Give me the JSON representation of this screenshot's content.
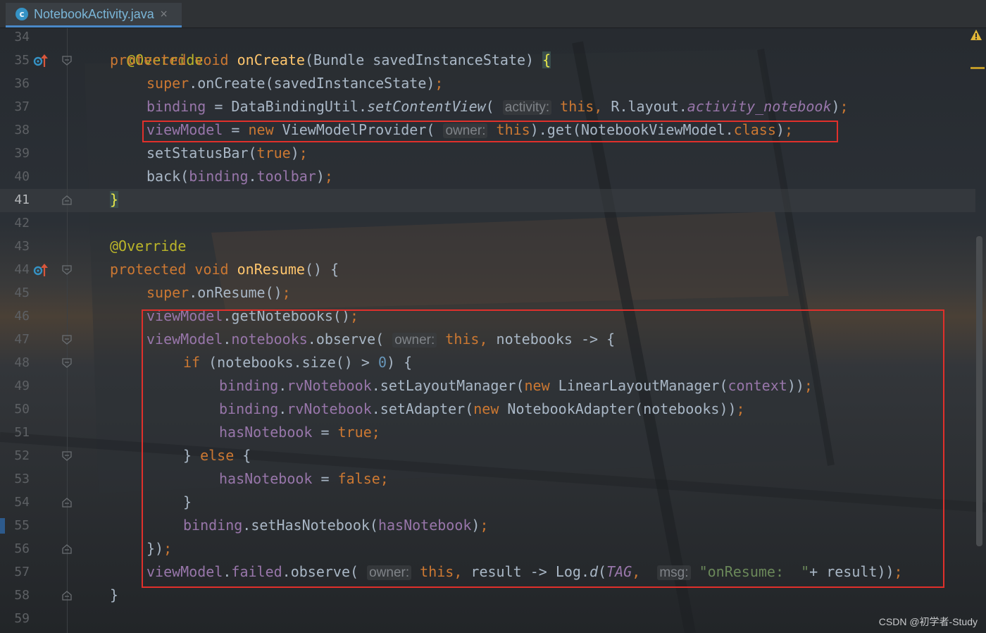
{
  "editor": {
    "tab": {
      "icon_letter": "c",
      "title": "NotebookActivity.java",
      "close_glyph": "×"
    }
  },
  "gutter": {
    "line_numbers": [
      "34",
      "35",
      "36",
      "37",
      "38",
      "39",
      "40",
      "41",
      "42",
      "43",
      "44",
      "45",
      "46",
      "47",
      "48",
      "49",
      "50",
      "51",
      "52",
      "53",
      "54",
      "55",
      "56",
      "57",
      "58",
      "59"
    ],
    "current_line": "41"
  },
  "code": {
    "l34": {
      "annotation": "@Override"
    },
    "l35": {
      "kw1": "protected",
      "kw2": "void",
      "method": "onCreate",
      "rest": "(Bundle savedInstanceState) ",
      "brace": "{"
    },
    "l36": {
      "kw": "super",
      "rest": ".onCreate(savedInstanceState)",
      "semi": ";"
    },
    "l37": {
      "field": "binding",
      "eq": " = DataBindingUtil.",
      "method": "setContentView",
      "open": "( ",
      "hint": "activity:",
      "kw": " this,",
      "mid": " R.layout.",
      "field2": "activity_notebook",
      "close": ")",
      "semi": ";"
    },
    "l38": {
      "field": "viewModel",
      "eq": " = ",
      "kw": "new",
      "ctor": " ViewModelProvider( ",
      "hint": "owner:",
      "kw2": " this",
      "mid": ").get(NotebookViewModel.",
      "kw3": "class",
      "close": ")",
      "semi": ";"
    },
    "l39": {
      "call": "setStatusBar(",
      "kw": "true",
      "close": ")",
      "semi": ";"
    },
    "l40": {
      "call": "back(",
      "field": "binding",
      "dot": ".",
      "field2": "toolbar",
      "close": ")",
      "semi": ";"
    },
    "l41": {
      "brace": "}"
    },
    "l43": {
      "annotation": "@Override"
    },
    "l44": {
      "kw1": "protected",
      "kw2": "void",
      "method": "onResume",
      "rest": "() {"
    },
    "l45": {
      "kw": "super",
      "rest": ".onResume()",
      "semi": ";"
    },
    "l46": {
      "field": "viewModel",
      "rest": ".getNotebooks()",
      "semi": ";"
    },
    "l47": {
      "field": "viewModel",
      "dot": ".",
      "field2": "notebooks",
      "call": ".observe( ",
      "hint": "owner:",
      "kw": " this,",
      "rest": " notebooks -> {"
    },
    "l48": {
      "kw": "if",
      "open": " (notebooks.size() > ",
      "num": "0",
      "close": ") {"
    },
    "l49": {
      "field": "binding",
      "dot": ".",
      "field2": "rvNotebook",
      "call": ".setLayoutManager(",
      "kw": "new",
      "ctor": " LinearLayoutManager(",
      "field3": "context",
      "close": "))",
      "semi": ";"
    },
    "l50": {
      "field": "binding",
      "dot": ".",
      "field2": "rvNotebook",
      "call": ".setAdapter(",
      "kw": "new",
      "ctor": " NotebookAdapter(notebooks))",
      "semi": ";"
    },
    "l51": {
      "field": "hasNotebook",
      "eq": " = ",
      "kw": "true",
      "semi": ";"
    },
    "l52": {
      "open": "} ",
      "kw": "else",
      "close": " {"
    },
    "l53": {
      "field": "hasNotebook",
      "eq": " = ",
      "kw": "false",
      "semi": ";"
    },
    "l54": {
      "brace": "}"
    },
    "l55": {
      "field": "binding",
      "call": ".setHasNotebook(",
      "field2": "hasNotebook",
      "close": ")",
      "semi": ";"
    },
    "l56": {
      "close": "})",
      "semi": ";"
    },
    "l57": {
      "field": "viewModel",
      "dot": ".",
      "field2": "failed",
      "call": ".observe( ",
      "hint": "owner:",
      "kw": " this,",
      "mid": " result -> Log.",
      "method": "d",
      "open": "(",
      "const": "TAG",
      "comma": ",",
      "sp": "  ",
      "hint2": "msg:",
      "str": " \"onResume:  \"",
      "rest": "+ result))",
      "semi": ";"
    },
    "l58": {
      "brace": "}"
    }
  },
  "watermark": "CSDN @初学者-Study",
  "colors": {
    "keyword": "#cc7832",
    "method": "#ffc66d",
    "annotation": "#bbb529",
    "field": "#9876aa",
    "number": "#6897bb",
    "string": "#6a8759",
    "text": "#a9b7c6",
    "highlight_box": "#e0302b"
  }
}
